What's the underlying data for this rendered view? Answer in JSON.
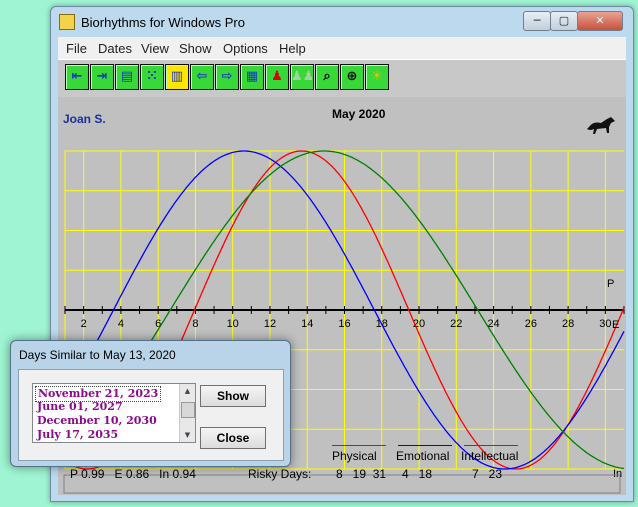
{
  "window": {
    "title": "Biorhythms for Windows Pro",
    "minimize": "─",
    "maximize": "▢",
    "close": "✕"
  },
  "menu": [
    "File",
    "Dates",
    "View",
    "Show",
    "Options",
    "Help"
  ],
  "toolbar": {
    "icons": [
      "exit-icon",
      "enter-icon",
      "printer-icon",
      "dice-icon",
      "notes-icon",
      "arrow-left-icon",
      "arrow-right-icon",
      "calendar-icon",
      "person-icon",
      "couple-icon",
      "zoom-icon",
      "target-icon",
      "lightbulb-icon"
    ]
  },
  "chart": {
    "person": "Joan S.",
    "title": "May 2020",
    "x_ticks": [
      "2",
      "4",
      "6",
      "8",
      "10",
      "12",
      "14",
      "16",
      "18",
      "20",
      "22",
      "24",
      "26",
      "28",
      "30"
    ],
    "end_labels": {
      "physical": "P",
      "emotional": "E",
      "intellectual": "In"
    },
    "colors": {
      "physical": "#ff0000",
      "emotional": "#0000ff",
      "intellectual": "#008000",
      "grid": "#ffff00",
      "background": "#c0c0c0"
    }
  },
  "chart_data": {
    "type": "line",
    "x_range": [
      1,
      31
    ],
    "ylim": [
      -1,
      1
    ],
    "grid": true,
    "series": [
      {
        "name": "Physical",
        "period": 23,
        "peak_day": 13.7
      },
      {
        "name": "Emotional",
        "period": 28,
        "peak_day": 10.6
      },
      {
        "name": "Intellectual",
        "period": 33,
        "peak_day": 14.9
      }
    ]
  },
  "info": {
    "values": "P 0.99   E 0.86   In 0.94",
    "risky_label": "Risky Days:",
    "legend": [
      {
        "name": "Physical",
        "days": "8   19  31"
      },
      {
        "name": "Emotional",
        "days": "4   18"
      },
      {
        "name": "Intellectual",
        "days": "7   23"
      }
    ]
  },
  "dialog": {
    "title": "Days Similar to May 13, 2020",
    "dates": [
      "November  21,  2023",
      "June  01,  2027",
      "December  10,  2030",
      "July  17,  2035"
    ],
    "show_label": "Show",
    "close_label": "Close"
  }
}
